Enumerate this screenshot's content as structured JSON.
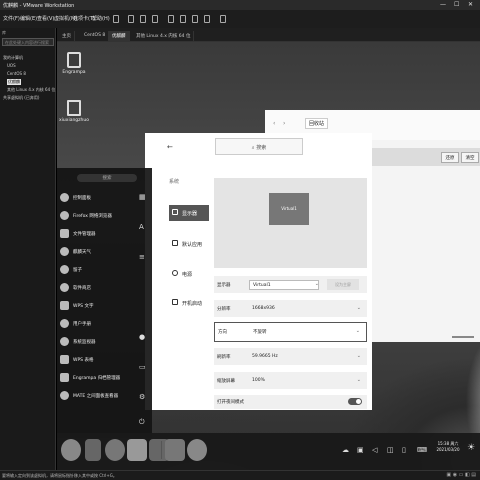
{
  "window": {
    "title": "优麒麟 - VMware Workstation",
    "controls": [
      "—",
      "☐",
      "✕"
    ]
  },
  "menubar": {
    "items": [
      "文件(F)",
      "编辑(E)",
      "查看(V)",
      "虚拟机(M)",
      "选项卡(T)",
      "帮助(H)"
    ]
  },
  "library": {
    "header": "库",
    "search_placeholder": "在此处键入内容进行搜索",
    "items": [
      "我的计算机",
      "UOS",
      "CentOS 8",
      "优麒麟",
      "其他 Linux 4.x 内核 64 位",
      "共享虚拟机 (已弃用)"
    ],
    "selected_index": 3
  },
  "tabs": [
    {
      "label": "主页"
    },
    {
      "label": "CentOS 8"
    },
    {
      "label": "优麒麟"
    },
    {
      "label": "其他 Linux 4.x 内核 64 位"
    }
  ],
  "desktop": {
    "icons": [
      {
        "label": "Engrampa",
        "icon": "archive-icon"
      },
      {
        "label": "xiuxiangzhuo",
        "icon": "home-folder-icon"
      }
    ]
  },
  "start_menu": {
    "search_placeholder": "搜索",
    "items": [
      "控制面板",
      "Firefox 网络浏览器",
      "文件管理器",
      "麒麟天气",
      "留子",
      "软件商店",
      "WPS 文字",
      "用户手册",
      "系统监视器",
      "WPS 表格",
      "Engrampa 归档管理器",
      "MATE 之间面板查看器"
    ]
  },
  "settings": {
    "search_placeholder": "搜索",
    "category": "系统",
    "nav": [
      {
        "label": "显示器",
        "icon": "monitor-icon"
      },
      {
        "label": "默认应用",
        "icon": "apps-icon"
      },
      {
        "label": "电源",
        "icon": "power-icon"
      },
      {
        "label": "开机启动",
        "icon": "startup-icon"
      }
    ],
    "active_nav": 0,
    "monitor_name": "Virtual1",
    "rows": {
      "display": {
        "label": "显示器",
        "value": "Virtual1",
        "button": "设为主屏"
      },
      "resolution": {
        "label": "分辨率",
        "value": "1668x936"
      },
      "orientation": {
        "label": "方向",
        "value": "不旋转"
      },
      "refresh": {
        "label": "刷新率",
        "value": "59.9665 Hz"
      },
      "scale": {
        "label": "缩放屏幕",
        "value": "100%"
      },
      "night": {
        "label": "打开夜间模式"
      }
    }
  },
  "recycle": {
    "path": "回收站",
    "buttons": [
      "还原",
      "清空"
    ]
  },
  "taskbar": {
    "clock_time": "15:38 周六",
    "clock_date": "2021/03/20"
  },
  "statusbar": {
    "text": "要将输入定向到该虚拟机，请将鼠标指针移入其中或按 Ctrl+G。"
  }
}
